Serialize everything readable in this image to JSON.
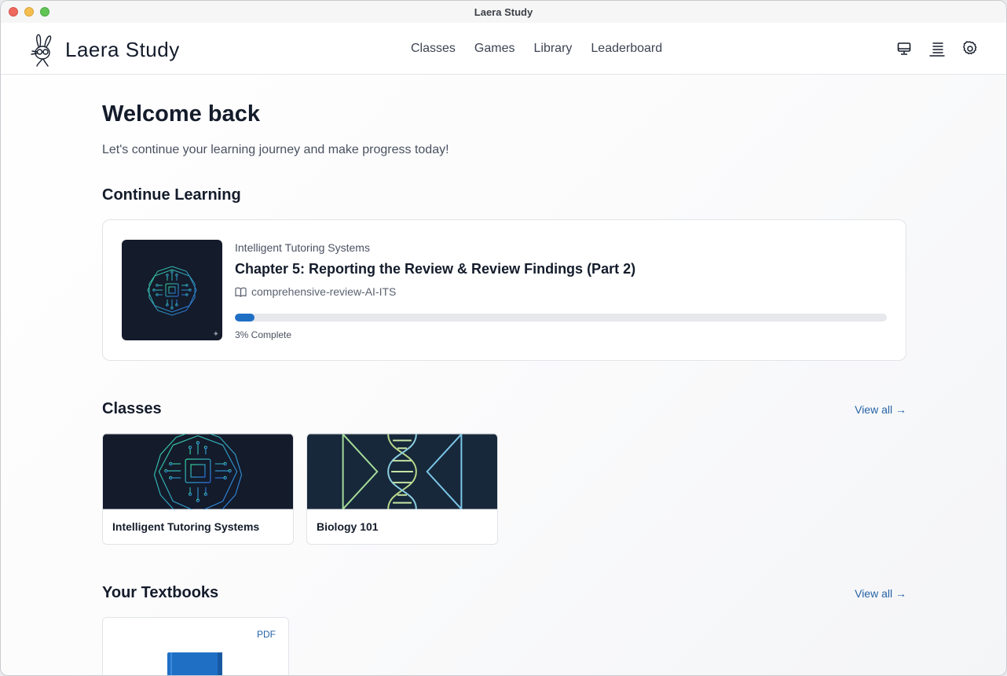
{
  "window": {
    "title": "Laera Study"
  },
  "brand": {
    "name": "Laera Study"
  },
  "nav": [
    {
      "label": "Classes"
    },
    {
      "label": "Games"
    },
    {
      "label": "Library"
    },
    {
      "label": "Leaderboard"
    }
  ],
  "header_icons": [
    "monitor-icon",
    "text-align-icon",
    "gear-icon"
  ],
  "welcome": {
    "title": "Welcome back",
    "subtitle": "Let's continue your learning journey and make progress today!"
  },
  "continue_learning": {
    "section_title": "Continue Learning",
    "course": "Intelligent Tutoring Systems",
    "chapter": "Chapter 5: Reporting the Review & Review Findings (Part 2)",
    "textbook": "comprehensive-review-AI-ITS",
    "progress_percent": 3,
    "progress_label": "3% Complete"
  },
  "classes": {
    "section_title": "Classes",
    "view_all": "View all →",
    "items": [
      {
        "name": "Intelligent Tutoring Systems"
      },
      {
        "name": "Biology 101"
      }
    ]
  },
  "textbooks": {
    "section_title": "Your Textbooks",
    "view_all": "View all →",
    "items": [
      {
        "badge": "PDF"
      }
    ]
  },
  "colors": {
    "accent": "#1f6fc5",
    "link": "#2563a6",
    "thumb_bg": "#141b2b"
  }
}
